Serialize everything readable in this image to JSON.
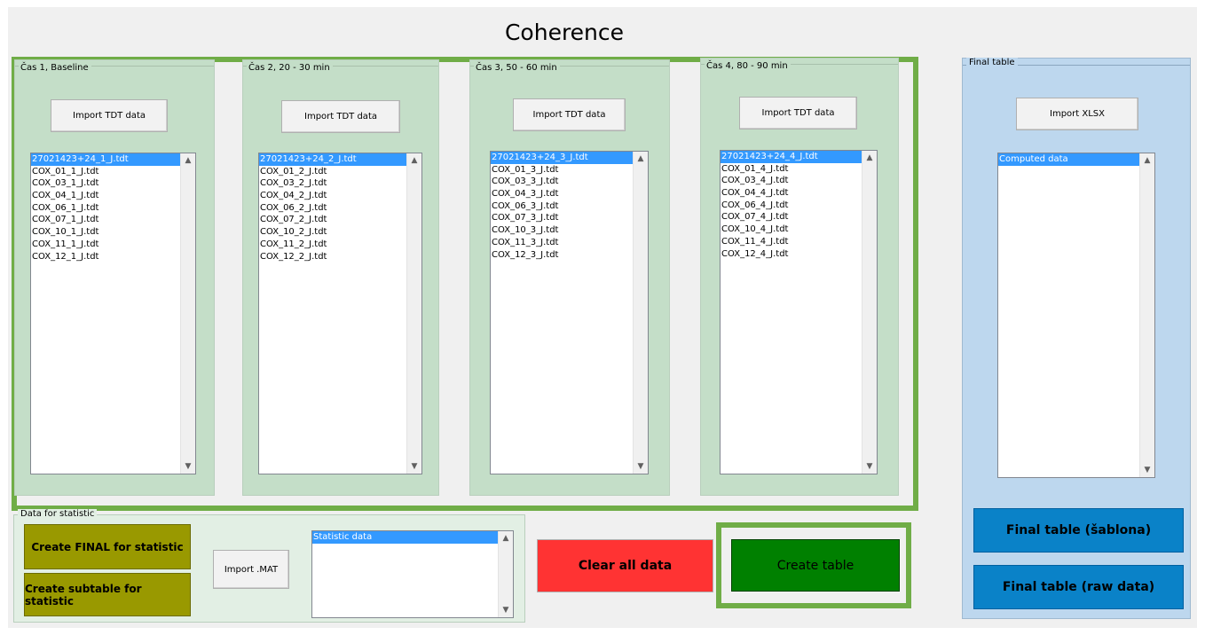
{
  "window": {
    "title": "Coherence"
  },
  "groups": [
    {
      "label": "Čas 1, Baseline",
      "import_label": "Import TDT data",
      "files": [
        "27021423+24_1_J.tdt",
        "COX_01_1_J.tdt",
        "COX_03_1_J.tdt",
        "COX_04_1_J.tdt",
        "COX_06_1_J.tdt",
        "COX_07_1_J.tdt",
        "COX_10_1_J.tdt",
        "COX_11_1_J.tdt",
        "COX_12_1_J.tdt"
      ]
    },
    {
      "label": "Čas 2, 20 - 30 min",
      "import_label": "Import TDT data",
      "files": [
        "27021423+24_2_J.tdt",
        "COX_01_2_J.tdt",
        "COX_03_2_J.tdt",
        "COX_04_2_J.tdt",
        "COX_06_2_J.tdt",
        "COX_07_2_J.tdt",
        "COX_10_2_J.tdt",
        "COX_11_2_J.tdt",
        "COX_12_2_J.tdt"
      ]
    },
    {
      "label": "Čas 3, 50 - 60 min",
      "import_label": "Import TDT data",
      "files": [
        "27021423+24_3_J.tdt",
        "COX_01_3_J.tdt",
        "COX_03_3_J.tdt",
        "COX_04_3_J.tdt",
        "COX_06_3_J.tdt",
        "COX_07_3_J.tdt",
        "COX_10_3_J.tdt",
        "COX_11_3_J.tdt",
        "COX_12_3_J.tdt"
      ]
    },
    {
      "label": "Čas 4, 80 - 90 min",
      "import_label": "Import TDT data",
      "files": [
        "27021423+24_4_J.tdt",
        "COX_01_4_J.tdt",
        "COX_03_4_J.tdt",
        "COX_04_4_J.tdt",
        "COX_06_4_J.tdt",
        "COX_07_4_J.tdt",
        "COX_10_4_J.tdt",
        "COX_11_4_J.tdt",
        "COX_12_4_J.tdt"
      ]
    }
  ],
  "statistic": {
    "label": "Data for statistic",
    "create_final": "Create FINAL for statistic",
    "create_subtable": "Create subtable for statistic",
    "import_mat": "Import .MAT",
    "list": [
      "Statistic data"
    ]
  },
  "actions": {
    "clear": "Clear all data",
    "create_table": "Create table"
  },
  "final_table": {
    "label": "Final table",
    "import_xlsx": "Import XLSX",
    "list": [
      "Computed data"
    ],
    "sablona": "Final table (šablona)",
    "raw": "Final table (raw data)"
  },
  "icons": {
    "up": "chevron-up-icon",
    "down": "chevron-down-icon"
  },
  "colors": {
    "frame_green": "#70ad47",
    "group_bg": "#c4dec8",
    "final_bg": "#bdd7ee",
    "olive": "#999900",
    "red": "#ff3333",
    "green": "#008000",
    "blue": "#0a82c8",
    "selection": "#3399ff"
  }
}
